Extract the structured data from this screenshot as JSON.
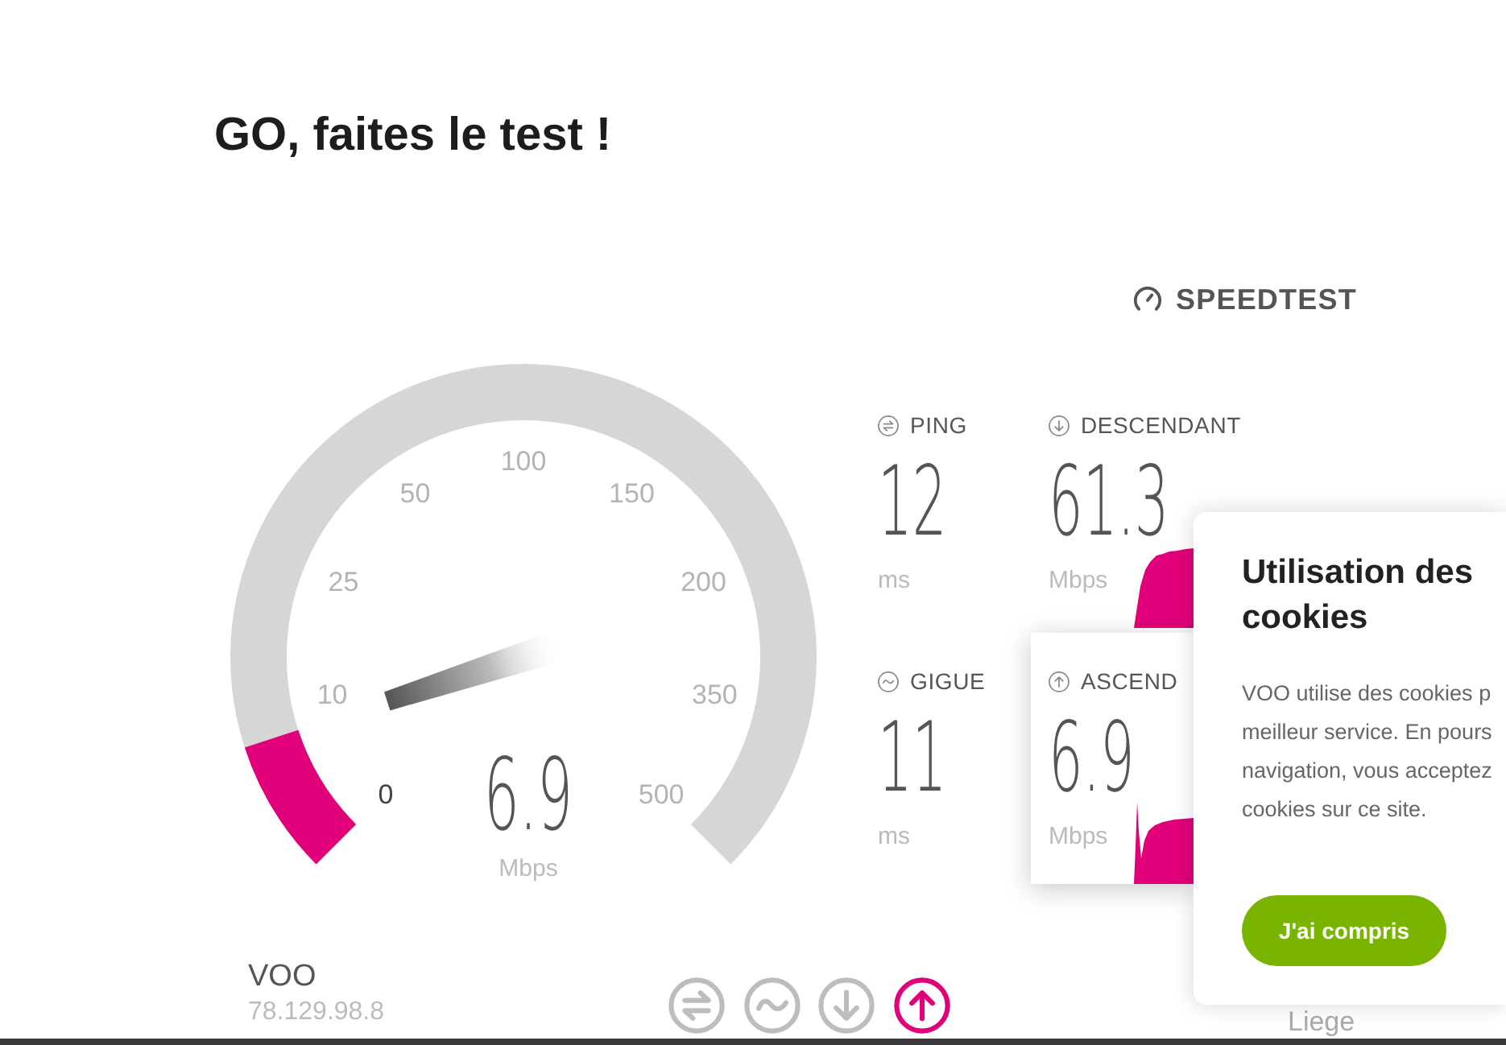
{
  "title": "GO, faites le test !",
  "brand": {
    "logo_text": "SPEEDTEST"
  },
  "gauge": {
    "ticks": [
      "0",
      "10",
      "25",
      "50",
      "100",
      "150",
      "200",
      "350",
      "500"
    ],
    "level": 0.1,
    "value": "6.9",
    "unit": "Mbps"
  },
  "stats": [
    {
      "kind": "ping",
      "label": "PING",
      "value": "12",
      "unit": "ms",
      "selected": false
    },
    {
      "kind": "download",
      "label": "DESCENDANT",
      "value": "61.3",
      "unit": "Mbps",
      "selected": false
    },
    {
      "kind": "jitter",
      "label": "GIGUE",
      "value": "11",
      "unit": "ms",
      "selected": false
    },
    {
      "kind": "upload",
      "label": "ASCEND",
      "value": "6.9",
      "unit": "Mbps",
      "selected": true
    }
  ],
  "provider": {
    "name": "VOO",
    "ip": "78.129.98.8"
  },
  "steps": [
    {
      "kind": "ping",
      "selected": false
    },
    {
      "kind": "jitter",
      "selected": false
    },
    {
      "kind": "download",
      "selected": false
    },
    {
      "kind": "upload",
      "selected": true
    }
  ],
  "location": "Liege",
  "cookie_banner": {
    "title": "Utilisation des cookies",
    "body": "VOO utilise des cookies p\nmeilleur service. En pours\nnavigation, vous acceptez\ncookies sur ce site.",
    "button": "J'ai compris"
  }
}
